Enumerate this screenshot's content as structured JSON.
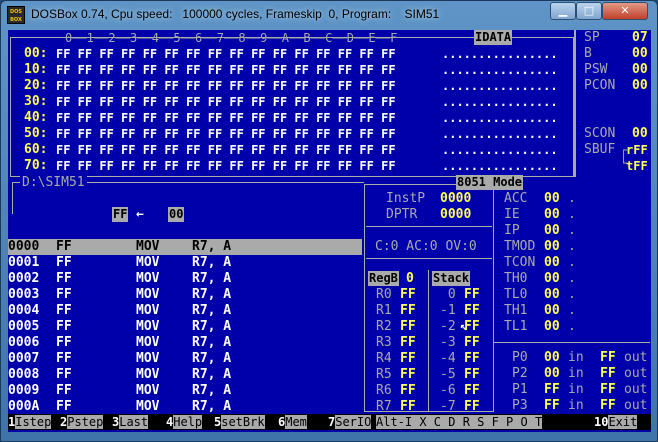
{
  "window": {
    "title": "DOSBox 0.74, Cpu speed:   100000 cycles, Frameskip  0, Program:    SIM51",
    "icon_label": "DOS BOX",
    "buttons": {
      "min_icon": "minimize-icon",
      "max_icon": "maximize-icon",
      "close_icon": "close-icon",
      "min": "▁",
      "max": "□",
      "close": "✕"
    }
  },
  "idata": {
    "title": "IDATA",
    "col_header": "0──1──2──3──4──5──6──7──8──9──A──B──C──D──E──F",
    "rows": [
      {
        "addr": "00:",
        "bytes": "FF FF FF FF FF FF FF FF FF FF FF FF FF FF FF FF",
        "ascii": "................"
      },
      {
        "addr": "10:",
        "bytes": "FF FF FF FF FF FF FF FF FF FF FF FF FF FF FF FF",
        "ascii": "................"
      },
      {
        "addr": "20:",
        "bytes": "FF FF FF FF FF FF FF FF FF FF FF FF FF FF FF FF",
        "ascii": "................"
      },
      {
        "addr": "30:",
        "bytes": "FF FF FF FF FF FF FF FF FF FF FF FF FF FF FF FF",
        "ascii": "................"
      },
      {
        "addr": "40:",
        "bytes": "FF FF FF FF FF FF FF FF FF FF FF FF FF FF FF FF",
        "ascii": "................"
      },
      {
        "addr": "50:",
        "bytes": "FF FF FF FF FF FF FF FF FF FF FF FF FF FF FF FF",
        "ascii": "................"
      },
      {
        "addr": "60:",
        "bytes": "FF FF FF FF FF FF FF FF FF FF FF FF FF FF FF FF",
        "ascii": "................"
      },
      {
        "addr": "70:",
        "bytes": "FF FF FF FF FF FF FF FF FF FF FF FF FF FF FF FF",
        "ascii": "................"
      }
    ]
  },
  "sfr_top": [
    {
      "name": "SP",
      "value": "07"
    },
    {
      "name": "B",
      "value": "00"
    },
    {
      "name": "PSW",
      "value": "00"
    },
    {
      "name": "PCON",
      "value": "00"
    }
  ],
  "serial": {
    "scon_name": "SCON",
    "scon_value": "00",
    "sbuf_name": "SBUF",
    "sbuf_r": "rFF",
    "sbuf_t": "tFF"
  },
  "code": {
    "file": "D:\\SIM51",
    "arrow_left": "FF",
    "arrow": "←",
    "arrow_right": "00",
    "lines": [
      {
        "addr": "0000",
        "byte": "FF",
        "mnem": "MOV",
        "ops": "R7, A"
      },
      {
        "addr": "0001",
        "byte": "FF",
        "mnem": "MOV",
        "ops": "R7, A"
      },
      {
        "addr": "0002",
        "byte": "FF",
        "mnem": "MOV",
        "ops": "R7, A"
      },
      {
        "addr": "0003",
        "byte": "FF",
        "mnem": "MOV",
        "ops": "R7, A"
      },
      {
        "addr": "0004",
        "byte": "FF",
        "mnem": "MOV",
        "ops": "R7, A"
      },
      {
        "addr": "0005",
        "byte": "FF",
        "mnem": "MOV",
        "ops": "R7, A"
      },
      {
        "addr": "0006",
        "byte": "FF",
        "mnem": "MOV",
        "ops": "R7, A"
      },
      {
        "addr": "0007",
        "byte": "FF",
        "mnem": "MOV",
        "ops": "R7, A"
      },
      {
        "addr": "0008",
        "byte": "FF",
        "mnem": "MOV",
        "ops": "R7, A"
      },
      {
        "addr": "0009",
        "byte": "FF",
        "mnem": "MOV",
        "ops": "R7, A"
      },
      {
        "addr": "000A",
        "byte": "FF",
        "mnem": "MOV",
        "ops": "R7, A"
      }
    ]
  },
  "cpu": {
    "mode": "8051 Mode",
    "instp_label": "InstP",
    "instp_value": "0000",
    "dptr_label": "DPTR",
    "dptr_value": "0000",
    "flags": "C:0 AC:0 OV:0"
  },
  "sfr_mid": [
    {
      "name": "ACC",
      "value": "00",
      "dot": "."
    },
    {
      "name": "IE",
      "value": "00",
      "dot": "."
    },
    {
      "name": "IP",
      "value": "00",
      "dot": "."
    },
    {
      "name": "TMOD",
      "value": "00",
      "dot": "."
    },
    {
      "name": "TCON",
      "value": "00",
      "dot": "."
    },
    {
      "name": "TH0",
      "value": "00",
      "dot": "."
    },
    {
      "name": "TL0",
      "value": "00",
      "dot": "."
    },
    {
      "name": "TH1",
      "value": "00",
      "dot": "."
    },
    {
      "name": "TL1",
      "value": "00",
      "dot": "."
    }
  ],
  "regs": {
    "title": "RegB",
    "bank": "0",
    "items": [
      {
        "name": "R0",
        "value": "FF"
      },
      {
        "name": "R1",
        "value": "FF"
      },
      {
        "name": "R2",
        "value": "FF"
      },
      {
        "name": "R3",
        "value": "FF"
      },
      {
        "name": "R4",
        "value": "FF"
      },
      {
        "name": "R5",
        "value": "FF"
      },
      {
        "name": "R6",
        "value": "FF"
      },
      {
        "name": "R7",
        "value": "FF"
      }
    ]
  },
  "stack": {
    "title": "Stack",
    "items": [
      {
        "off": " 0",
        "value": "FF"
      },
      {
        "off": "-1",
        "value": "FF"
      },
      {
        "off": "-2",
        "value": "FF"
      },
      {
        "off": "-3",
        "value": "FF"
      },
      {
        "off": "-4",
        "value": "FF"
      },
      {
        "off": "-5",
        "value": "FF"
      },
      {
        "off": "-6",
        "value": "FF"
      },
      {
        "off": "-7",
        "value": "FF"
      }
    ]
  },
  "ports": [
    {
      "name": "P0",
      "in": "00",
      "in_label": "in",
      "out": "FF",
      "out_label": "out"
    },
    {
      "name": "P2",
      "in": "00",
      "in_label": "in",
      "out": "FF",
      "out_label": "out"
    },
    {
      "name": "P1",
      "in": "FF",
      "in_label": "in",
      "out": "FF",
      "out_label": "out"
    },
    {
      "name": "P3",
      "in": "FF",
      "in_label": "in",
      "out": "FF",
      "out_label": "out"
    }
  ],
  "fkeys": [
    {
      "n": "1",
      "label": "Istep"
    },
    {
      "n": "2",
      "label": "Pstep"
    },
    {
      "n": "3",
      "label": "Last"
    },
    {
      "n": "4",
      "label": "Help"
    },
    {
      "n": "5",
      "label": "setBrk"
    },
    {
      "n": "6",
      "label": "Mem"
    },
    {
      "n": "7",
      "label": "SerIO"
    }
  ],
  "altbar": "Alt-I X C D R S F P O T",
  "exit_key": {
    "n": "10",
    "label": "Exit"
  }
}
